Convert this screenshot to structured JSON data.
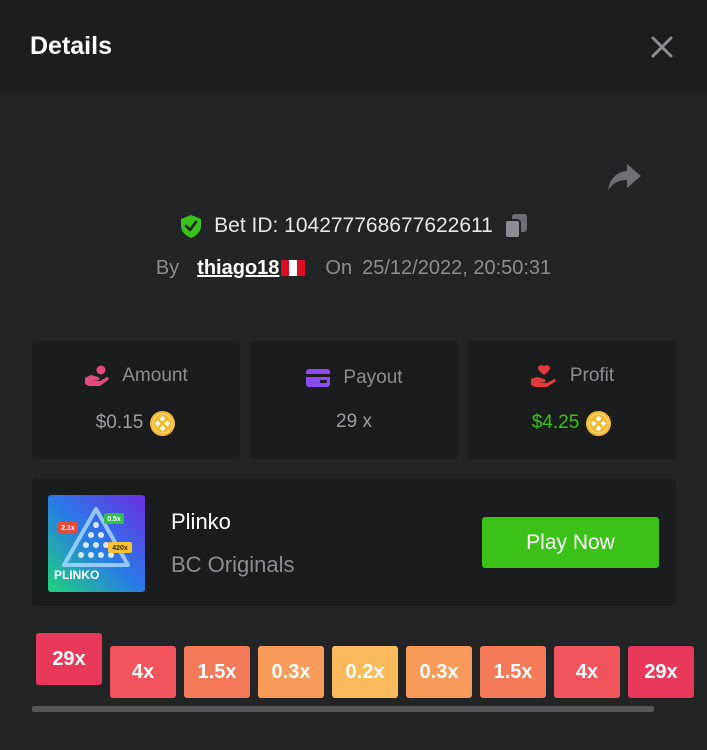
{
  "header": {
    "title": "Details"
  },
  "bet": {
    "id_label": "Bet ID: 104277768677622611",
    "by_label": "By",
    "user": "thiago18",
    "on_label": "On",
    "date": "25/12/2022, 20:50:31"
  },
  "stats": {
    "amount": {
      "label": "Amount",
      "value": "$0.15",
      "icon": "hand-coins-icon",
      "color": "#e24b7a"
    },
    "payout": {
      "label": "Payout",
      "value": "29 x",
      "icon": "card-icon",
      "color": "#8a4cf2"
    },
    "profit": {
      "label": "Profit",
      "value": "$4.25",
      "icon": "hand-heart-icon",
      "color": "#e23b3b"
    }
  },
  "game": {
    "name": "Plinko",
    "provider": "BC Originals",
    "play_label": "Play Now",
    "thumb_text": "PLINKO",
    "thumb_badges": [
      "2.1x",
      "0.5x",
      "420x"
    ]
  },
  "multipliers": [
    "29x",
    "4x",
    "1.5x",
    "0.3x",
    "0.2x",
    "0.3x",
    "1.5x",
    "4x",
    "29x"
  ],
  "multiplier_colors": [
    "#e8395a",
    "#f2545b",
    "#f57a5a",
    "#f89c5c",
    "#fbbb5d",
    "#f89c5c",
    "#f57a5a",
    "#f2545b",
    "#e8395a"
  ],
  "colors": {
    "accent": "#3bc117",
    "background": "#232426",
    "card": "#1b1c1e"
  }
}
